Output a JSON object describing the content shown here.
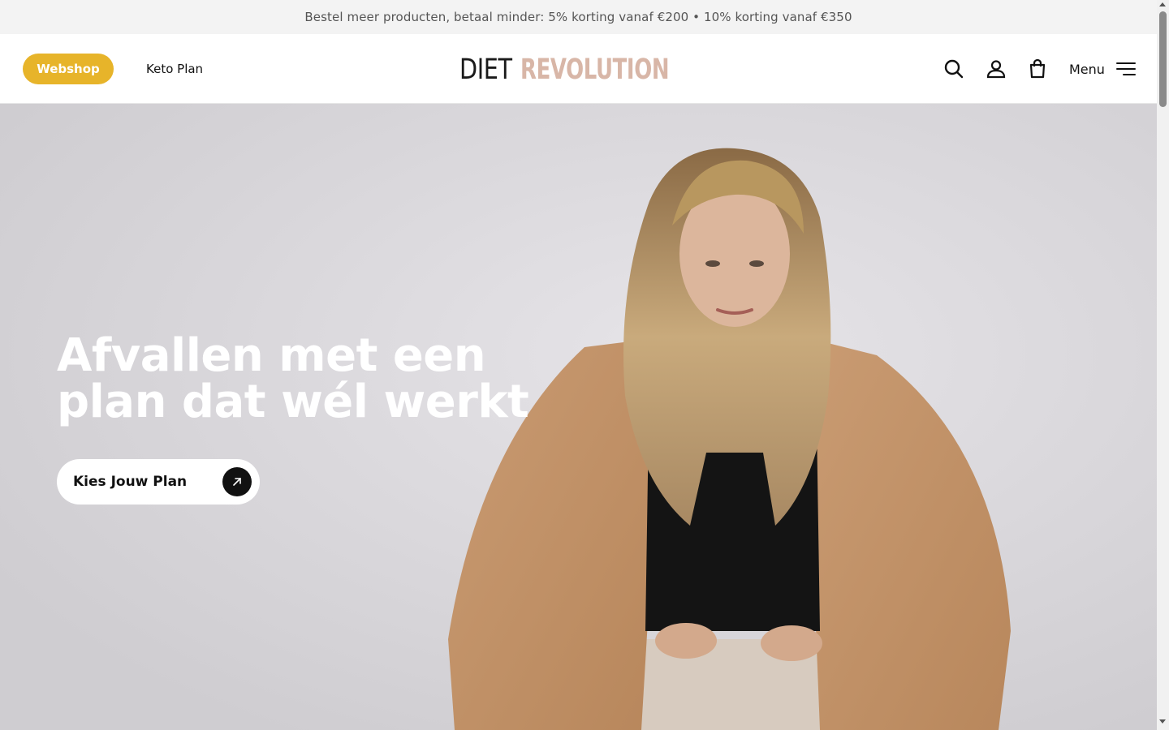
{
  "promo": {
    "text": "Bestel meer producten, betaal minder: 5% korting vanaf €200 • 10% korting vanaf €350"
  },
  "header": {
    "webshop_label": "Webshop",
    "keto_label": "Keto Plan",
    "logo_word_1": "DIET",
    "logo_word_2": "REVOLUTION",
    "icons": [
      "search-icon",
      "account-icon",
      "shopping-bag-icon",
      "hamburger-menu-icon"
    ],
    "menu_label": "Menu"
  },
  "hero": {
    "title_line_1": "Afvallen met een",
    "title_line_2": "plan dat wél werkt",
    "cta_label": "Kies Jouw Plan",
    "cta_icon": "arrow-up-right-icon"
  },
  "colors": {
    "accent": "#e7b42a",
    "logo_secondary": "#d8b6a7",
    "dark": "#111111",
    "hero_background": "#d6d4d8",
    "jacket": "#c99b72",
    "promo_background": "#f3f3f3"
  }
}
